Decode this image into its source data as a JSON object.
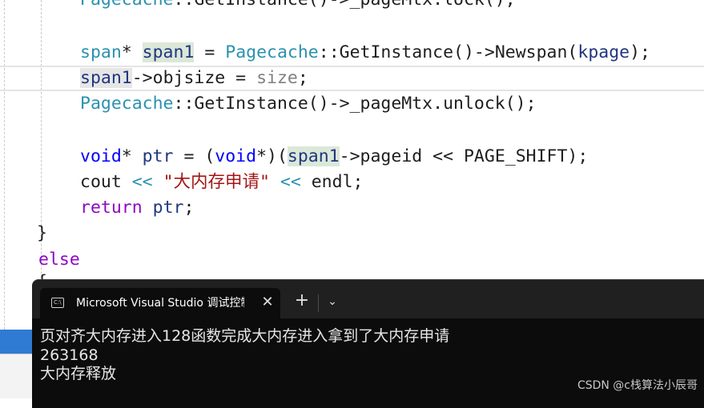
{
  "editor": {
    "line0": {
      "a": "Pagecache",
      "b": "::",
      "c": "GetInstance",
      "d": "()->_pageMtx.",
      "e": "lock",
      "f": "();"
    },
    "line1": {
      "type": "span",
      "star": "* ",
      "var": "span1",
      "eq": " = ",
      "cls": "Pagecache",
      "sep": "::",
      "fn": "GetInstance",
      "arrow": "()->",
      "fn2": "Newspan",
      "open": "(",
      "arg": "kpage",
      "close": ");"
    },
    "line2": {
      "var": "span1",
      "arrow": "->objsize = ",
      "par": "size",
      "semi": ";"
    },
    "line3": {
      "cls": "Pagecache",
      "sep": "::",
      "fn": "GetInstance",
      "arrow": "()->_pageMtx.",
      "fn2": "unlock",
      "end": "();"
    },
    "line4": {
      "kw": "void",
      "star": "* ",
      "var": "ptr",
      "eq": " = (",
      "kw2": "void",
      "cast": "*)(",
      "var2": "span1",
      "rest": "->pageid << PAGE_SHIFT);"
    },
    "line5": {
      "id": "cout",
      "op": " << ",
      "str": "\"大内存申请\"",
      "op2": " << ",
      "id2": "endl",
      "semi": ";"
    },
    "line6": {
      "kw": "return",
      "sp": " ",
      "var": "ptr",
      "semi": ";"
    },
    "line7": {
      "brace": "}"
    },
    "line8": {
      "kw": "else"
    },
    "line9": {
      "brace": "{"
    }
  },
  "terminal": {
    "tab_title": "Microsoft Visual Studio 调试控制台",
    "tab_icon_text": "C:\\",
    "close_glyph": "✕",
    "new_tab_glyph": "+",
    "dropdown_glyph": "⌄",
    "output": [
      "页对齐大内存进入128函数完成大内存进入拿到了大内存申请",
      "263168",
      "大内存释放"
    ]
  },
  "watermark": "CSDN @c栈算法小辰哥",
  "colors": {
    "type": "#2b91af",
    "keyword": "#0000ff",
    "control": "#8f08c4",
    "string": "#a31515",
    "terminal_bg": "#0c0c0c",
    "tabbar_bg": "#202020",
    "side_strip": "#2f7bd4"
  }
}
